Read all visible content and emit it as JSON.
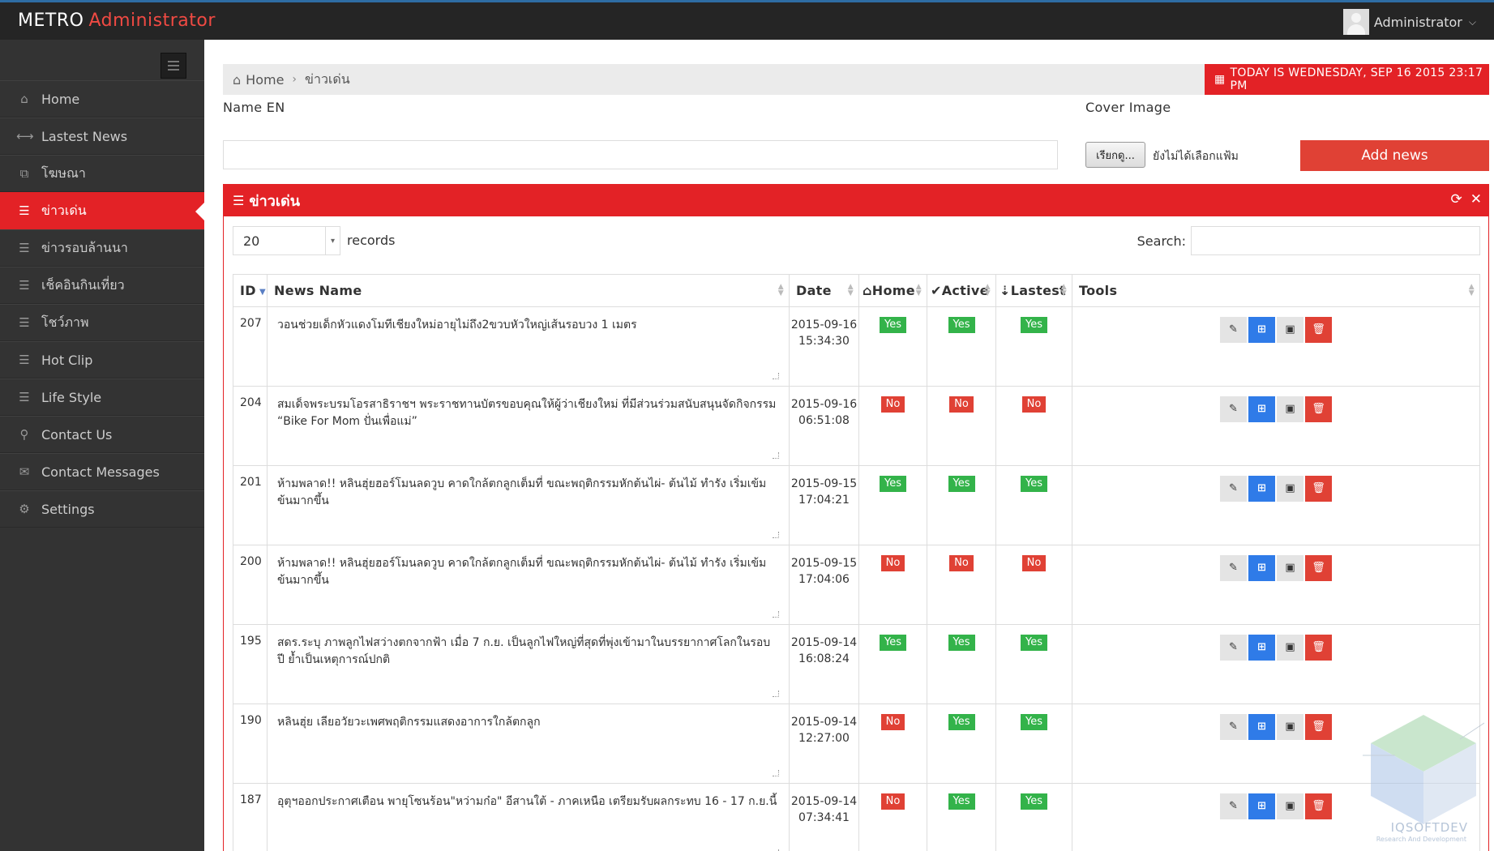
{
  "header": {
    "brand_main": "METRO",
    "brand_accent": "Administrator",
    "user_name": "Administrator",
    "caret": "⌵"
  },
  "sidebar": {
    "items": [
      {
        "label": "Home",
        "icon": "home-icon",
        "glyph": "⌂"
      },
      {
        "label": "Lastest News",
        "icon": "arrows-horizontal-icon",
        "glyph": "⟷"
      },
      {
        "label": "โฆษณา",
        "icon": "external-link-icon",
        "glyph": "⧉"
      },
      {
        "label": "ข่าวเด่น",
        "icon": "list-icon",
        "glyph": "☰",
        "active": true
      },
      {
        "label": "ข่าวรอบล้านนา",
        "icon": "list-icon",
        "glyph": "☰"
      },
      {
        "label": "เช็คอินกินเที่ยว",
        "icon": "list-icon",
        "glyph": "☰"
      },
      {
        "label": "โชว์ภาพ",
        "icon": "list-icon",
        "glyph": "☰"
      },
      {
        "label": "Hot Clip",
        "icon": "list-icon",
        "glyph": "☰"
      },
      {
        "label": "Life Style",
        "icon": "list-icon",
        "glyph": "☰"
      },
      {
        "label": "Contact Us",
        "icon": "map-marker-icon",
        "glyph": "⚲"
      },
      {
        "label": "Contact Messages",
        "icon": "envelope-icon",
        "glyph": "✉"
      },
      {
        "label": "Settings",
        "icon": "gears-icon",
        "glyph": "⚙"
      }
    ]
  },
  "breadcrumb": {
    "home": "Home",
    "current": "ข่าวเด่น"
  },
  "today": "TODAY IS WEDNESDAY, SEP 16 2015 23:17 PM",
  "form": {
    "name_label": "Name EN",
    "name_value": "",
    "cover_label": "Cover Image",
    "file_button": "เรียกดู...",
    "file_status": "ยังไม่ได้เลือกแฟ้ม",
    "add_button": "Add news"
  },
  "panel": {
    "title": "ข่าวเด่น",
    "records_value": "20",
    "records_label": "records",
    "search_label": "Search:"
  },
  "table": {
    "columns": [
      "ID",
      "News Name",
      "Date",
      "Home",
      "Active",
      "Lastest",
      "Tools"
    ],
    "rows": [
      {
        "id": "207",
        "name": "วอนช่วยเด็กหัวแดงโมทีเชียงใหม่อายุไม่ถึง2ขวบหัวใหญ่เส้นรอบวง 1 เมตร",
        "date": "2015-09-16",
        "time": "15:34:30",
        "home": "Yes",
        "active": "Yes",
        "lastest": "Yes"
      },
      {
        "id": "204",
        "name": "สมเด็จพระบรมโอรสาธิราชฯ  พระราชทานบัตรขอบคุณให้ผู้ว่าเชียงใหม่ ที่มีส่วนร่วมสนับสนุนจัดกิจกรรม “Bike For Mom ปั่นเพื่อแม่”",
        "date": "2015-09-16",
        "time": "06:51:08",
        "home": "No",
        "active": "No",
        "lastest": "No"
      },
      {
        "id": "201",
        "name": "ห้ามพลาด!! หลินฮุ่ยฮอร์โมนลดวูบ คาดใกล้ตกลูกเต็มที่  ขณะพฤติกรรมหักต้นไผ่- ต้นไม้ ทำรัง เริ่มเข้มข้นมากขึ้น",
        "date": "2015-09-15",
        "time": "17:04:21",
        "home": "Yes",
        "active": "Yes",
        "lastest": "Yes"
      },
      {
        "id": "200",
        "name": "ห้ามพลาด!! หลินฮุ่ยฮอร์โมนลดวูบ คาดใกล้ตกลูกเต็มที่  ขณะพฤติกรรมหักต้นไผ่- ต้นไม้ ทำรัง เริ่มเข้มข้นมากขึ้น",
        "date": "2015-09-15",
        "time": "17:04:06",
        "home": "No",
        "active": "No",
        "lastest": "No"
      },
      {
        "id": "195",
        "name": "สดร.ระบุ ภาพลูกไฟสว่างตกจากฟ้า เมื่อ 7 ก.ย. เป็นลูกไฟใหญ่ที่สุดที่พุ่งเข้ามาในบรรยากาศโลกในรอบปี  ย้ำเป็นเหตุการณ์ปกติ",
        "date": "2015-09-14",
        "time": "16:08:24",
        "home": "Yes",
        "active": "Yes",
        "lastest": "Yes"
      },
      {
        "id": "190",
        "name": "หลินฮุ่ย เลียอวัยวะเพศพฤติกรรมแสดงอาการใกล้ตกลูก",
        "date": "2015-09-14",
        "time": "12:27:00",
        "home": "No",
        "active": "Yes",
        "lastest": "Yes"
      },
      {
        "id": "187",
        "name": "อุตุฯออกประกาศเตือน พายุโซนร้อน\"หว่ามก๋อ\" อีสานใต้ - ภาคเหนือ  เตรียมรับผลกระทบ 16 - 17 ก.ย.นี้",
        "date": "2015-09-14",
        "time": "07:34:41",
        "home": "No",
        "active": "Yes",
        "lastest": "Yes"
      }
    ]
  },
  "watermark": {
    "text": "IQSOFTDEV",
    "sub": "Research And Development"
  }
}
